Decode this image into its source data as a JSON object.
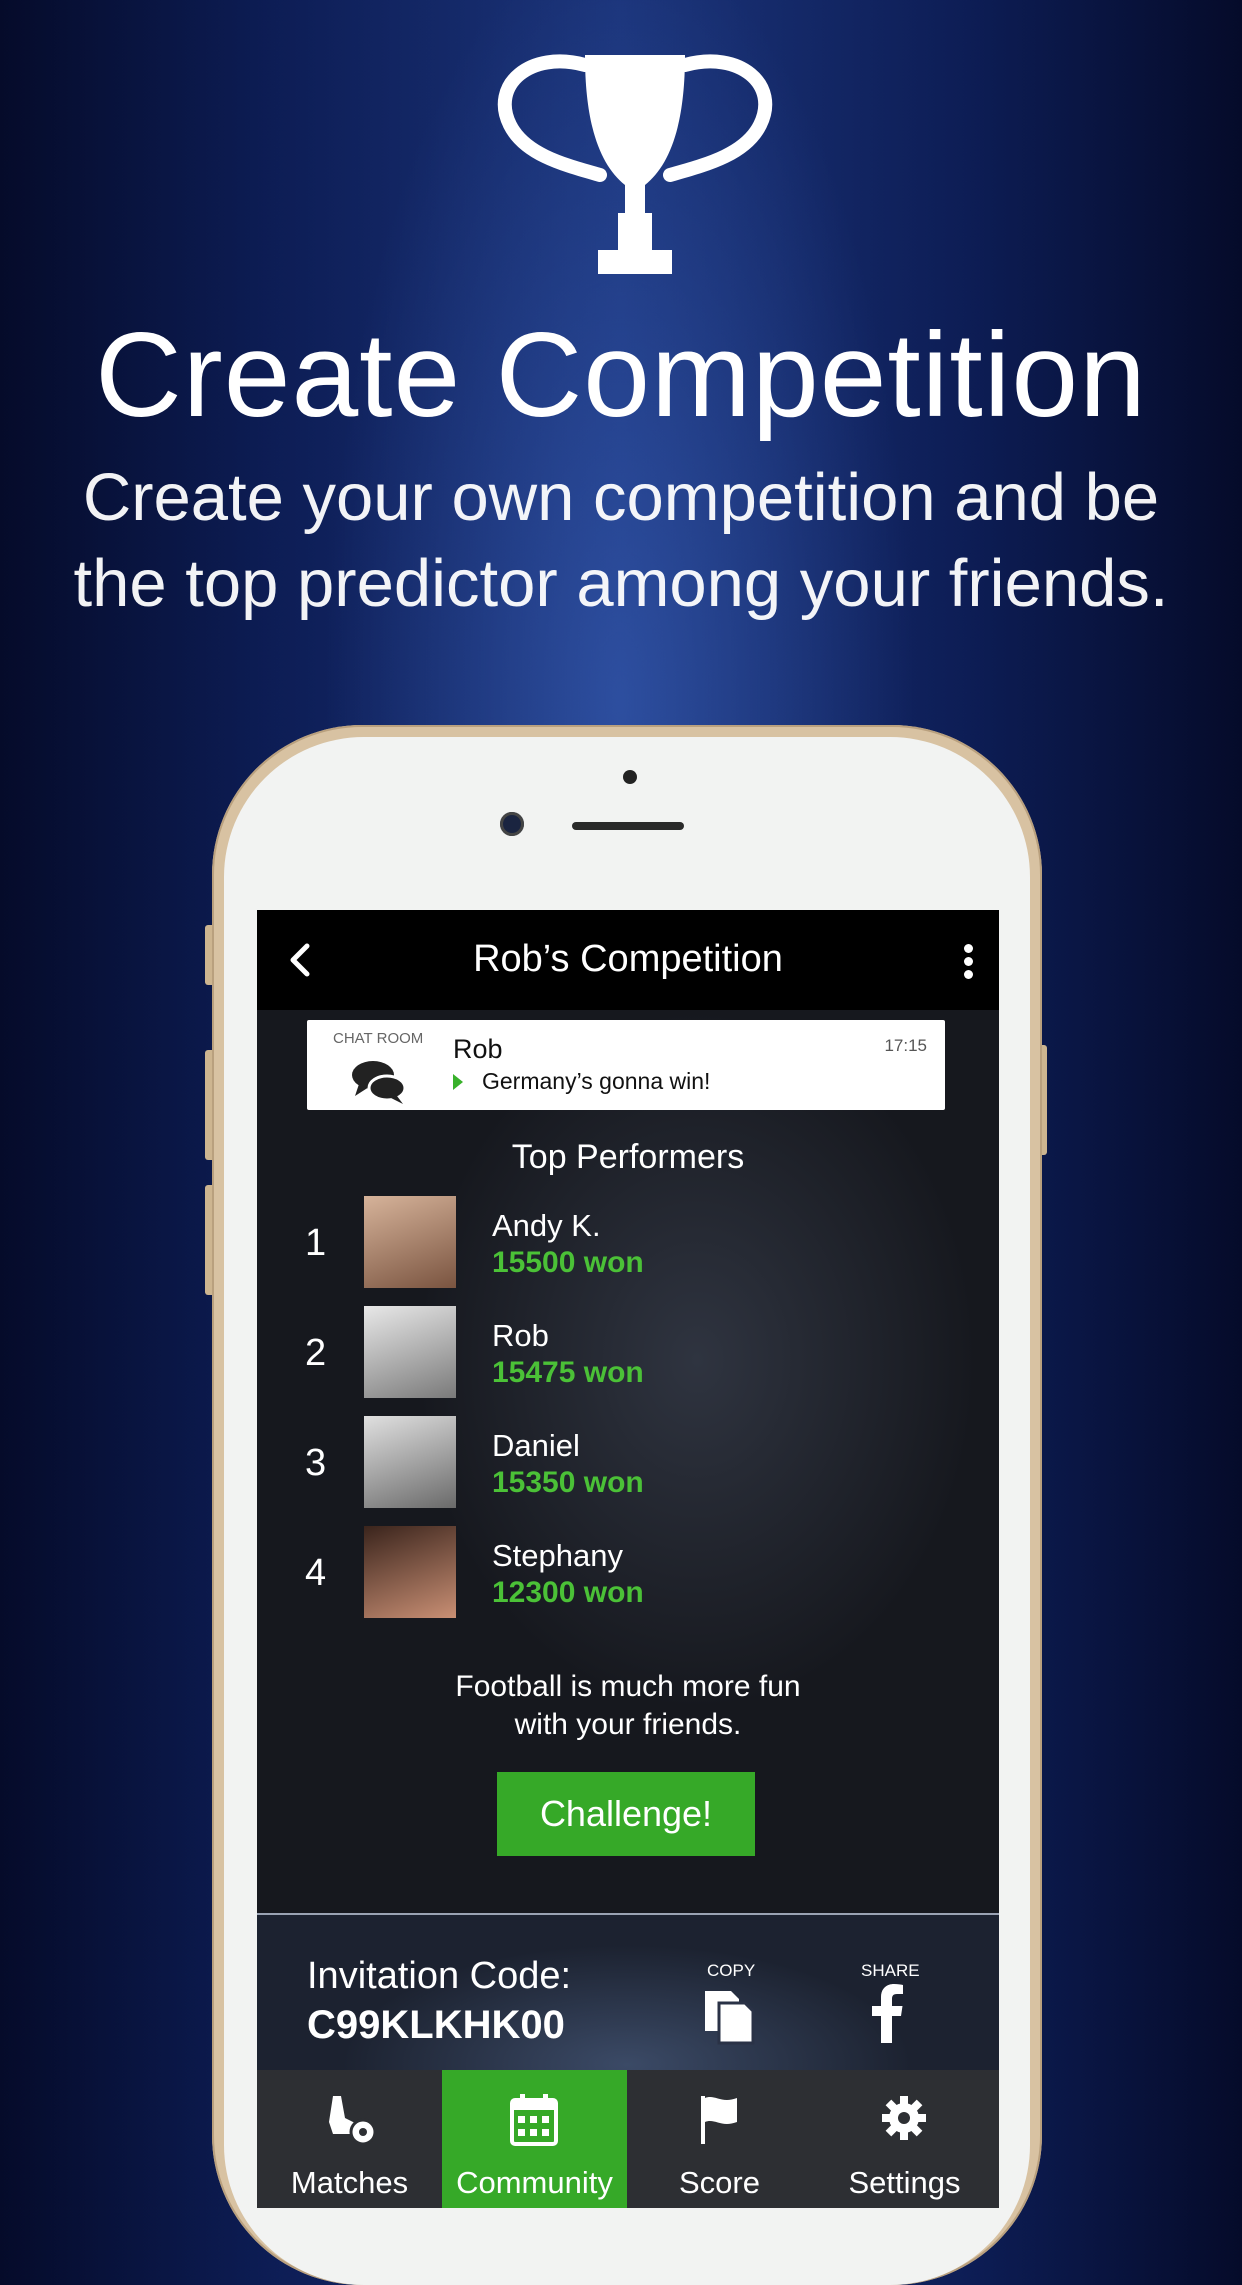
{
  "headline": "Create Competition",
  "subline_line1": "Create your own competition and be",
  "subline_line2": "the top predictor among your friends.",
  "app": {
    "nav_title": "Rob’s Competition",
    "chat": {
      "label": "CHAT ROOM",
      "name": "Rob",
      "message": "Germany’s gonna win!",
      "time": "17:15"
    },
    "top_performers_title": "Top Performers",
    "performers": [
      {
        "rank": "1",
        "name": "Andy K.",
        "score": "15500 won"
      },
      {
        "rank": "2",
        "name": "Rob",
        "score": "15475 won"
      },
      {
        "rank": "3",
        "name": "Daniel",
        "score": "15350 won"
      },
      {
        "rank": "4",
        "name": "Stephany",
        "score": "12300 won"
      }
    ],
    "fun_line1": "Football is much more fun",
    "fun_line2": "with your friends.",
    "challenge_label": "Challenge!",
    "invite": {
      "label": "Invitation Code:",
      "code": "C99KLKHK00",
      "copy_label": "COPY",
      "share_label": "SHARE"
    },
    "tabs": [
      {
        "label": "Matches",
        "icon": "football-boot-icon"
      },
      {
        "label": "Community",
        "icon": "calendar-icon",
        "active": true
      },
      {
        "label": "Score",
        "icon": "flag-icon"
      },
      {
        "label": "Settings",
        "icon": "gear-icon"
      }
    ],
    "accent_color": "#36a928",
    "score_color": "#4bc137"
  }
}
